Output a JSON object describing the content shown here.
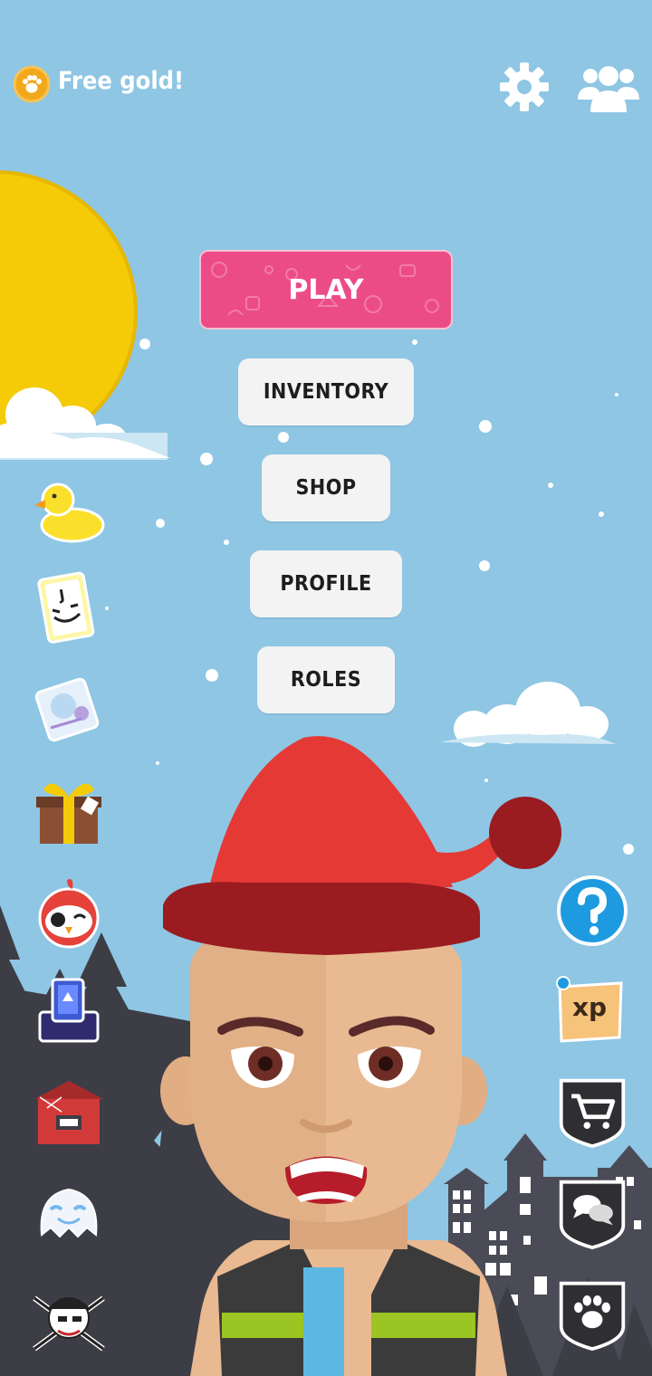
{
  "top_bar": {
    "free_gold_label": "Free gold!",
    "coin_icon": "paw-coin-icon",
    "settings_icon": "gear-icon",
    "friends_icon": "friends-icon"
  },
  "menu": {
    "play_label": "PLAY",
    "inventory_label": "INVENTORY",
    "shop_label": "SHOP",
    "profile_label": "PROFILE",
    "roles_label": "ROLES"
  },
  "left_sidebar": {
    "items": [
      {
        "icon": "rubber-duck-icon"
      },
      {
        "icon": "joker-card-icon"
      },
      {
        "icon": "sticker-card-icon"
      },
      {
        "icon": "gift-box-icon"
      },
      {
        "icon": "pirate-bird-icon"
      },
      {
        "icon": "card-chest-icon"
      },
      {
        "icon": "haunted-house-icon"
      },
      {
        "icon": "ghost-icon"
      },
      {
        "icon": "pirate-skull-icon"
      }
    ]
  },
  "right_sidebar": {
    "help_icon": "question-mark-icon",
    "xp_label": "xp",
    "cart_icon": "shopping-cart-icon",
    "chat_icon": "chat-bubbles-icon",
    "paw_icon": "paw-icon"
  },
  "colors": {
    "sky": "#8ec6e4",
    "play_button": "#ec4c86",
    "menu_button": "#f3f3f3",
    "sun": "#f5cb08",
    "hat": "#e53935",
    "help_button": "#1e9be0"
  }
}
